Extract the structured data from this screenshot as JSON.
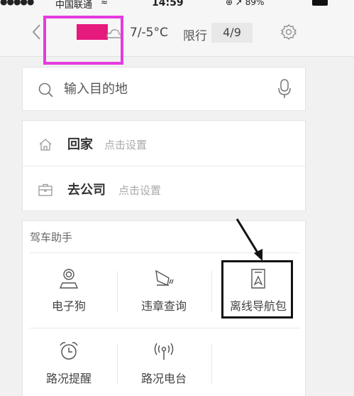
{
  "status_bar": {
    "signal_dots": "●●●●●",
    "carrier": "中国联通",
    "wifi_glyph": "≈",
    "time": "14:59",
    "right_icons": "⊕ ➚ 89%",
    "battery_percent": 89
  },
  "nav": {
    "back_icon": "chevron-left-icon",
    "weather_icon": "cloud-icon",
    "temperature": "7/-5°C",
    "limit_label": "限行",
    "limit_value": "4/9",
    "settings_icon": "gear-icon"
  },
  "search": {
    "placeholder": "输入目的地",
    "left_icon": "search-icon",
    "right_icon": "microphone-icon"
  },
  "places": [
    {
      "icon": "home-icon",
      "title": "回家",
      "hint": "点击设置"
    },
    {
      "icon": "briefcase-icon",
      "title": "去公司",
      "hint": "点击设置"
    }
  ],
  "assistant": {
    "title": "驾车助手",
    "tools": [
      {
        "label": "电子狗",
        "icon": "radar-dog-icon"
      },
      {
        "label": "违章查询",
        "icon": "camera-icon"
      },
      {
        "label": "离线导航包",
        "icon": "offline-map-icon"
      },
      {
        "label": "路况提醒",
        "icon": "alarm-clock-icon"
      },
      {
        "label": "路况电台",
        "icon": "radio-icon"
      }
    ]
  },
  "colors": {
    "highlight": "#e53be0",
    "redaction": "#e6197d",
    "annotation": "#111111"
  }
}
